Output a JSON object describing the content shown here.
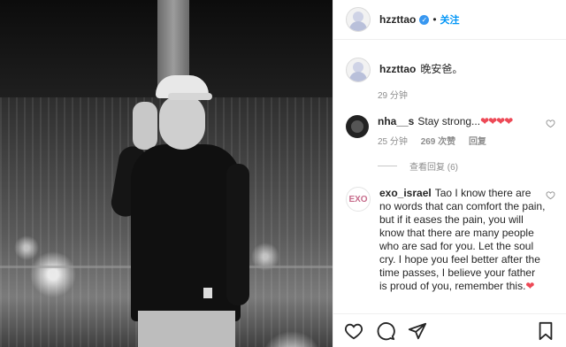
{
  "post": {
    "username": "hzzttao",
    "verified_glyph": "✓",
    "separator": "•",
    "follow_label": "关注",
    "caption": "晚安爸。",
    "caption_time": "29 分钟"
  },
  "comments": [
    {
      "username": "nha__s",
      "text": "Stay strong...",
      "hearts": "❤❤❤❤",
      "time": "25 分钟",
      "likes": "269 次赞",
      "reply_label": "回复",
      "view_replies": "查看回复 (6)"
    },
    {
      "username": "exo_israel",
      "avatar_text": "EXO",
      "text": "Tao I know there are no words that can comfort the pain, but if it eases the pain, you will know that there are many people who are sad for you. Let the soul cry. I hope you feel better after the time passes, I believe your father is proud of you, remember this.",
      "hearts": "❤"
    }
  ],
  "icons": {
    "like": "heart-icon",
    "comment": "comment-icon",
    "share": "send-icon",
    "save": "bookmark-icon"
  },
  "colors": {
    "follow": "#0095f6",
    "verified": "#3897f0",
    "heart": "#ed4956"
  }
}
